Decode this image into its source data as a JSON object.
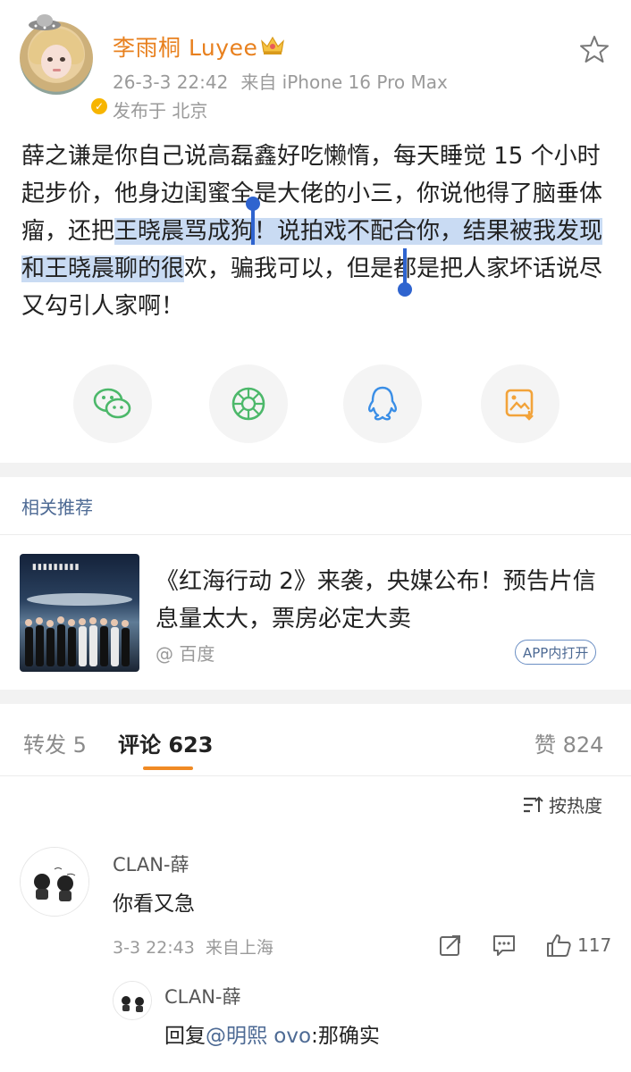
{
  "post": {
    "username": "李雨桐 Luyee",
    "time": "26-3-3 22:42",
    "device": "来自 iPhone 16 Pro Max",
    "location": "发布于 北京",
    "body_before": "薛之谦是你自己说高磊鑫好吃懒惰，每天睡觉 15 个小时起步价，他身边闺蜜全是大佬的小三，你说他得了脑垂体瘤，还把",
    "body_highlight": "王晓晨骂成狗！说拍戏不配合你，结果被我发现和王晓晨聊的很",
    "body_after": "欢，骗我可以，但是都是把人家坏话说尽又勾引人家啊！",
    "share_icons": [
      "wechat-icon",
      "moments-icon",
      "qq-icon",
      "save-image-icon"
    ]
  },
  "related": {
    "title": "相关推荐",
    "headline": "《红海行动 2》来袭，央媒公布！预告片信息量太大，票房必定大卖",
    "source": "@ 百度",
    "app_open": "APP内打开"
  },
  "tabs": {
    "repost": "转发 5",
    "comments": "评论 623",
    "likes": "赞 824"
  },
  "sort_label": "按热度",
  "comments": [
    {
      "name": "CLAN-薛",
      "text": "你看又急",
      "time": "3-3 22:43",
      "location": "来自上海",
      "likes": "117"
    }
  ],
  "reply": {
    "name": "CLAN-薛",
    "prefix": "回复",
    "mention": "@明熙 ovo",
    "text": ":那确实"
  },
  "colors": {
    "accent": "#f08a24",
    "username": "#e8801e",
    "link": "#4d6a94",
    "highlight": "#c9dbf3",
    "selection": "#2f64cf"
  }
}
